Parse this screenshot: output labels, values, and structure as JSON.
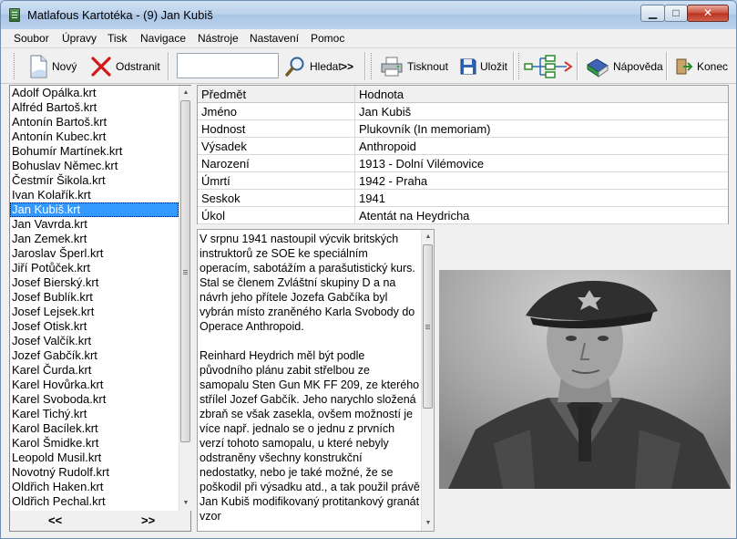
{
  "window": {
    "title": "Matlafous Kartotéka - (9) Jan Kubiš"
  },
  "menu": [
    "Soubor",
    "Úpravy",
    "Tisk",
    "Navigace",
    "Nástroje",
    "Nastavení",
    "Pomoc"
  ],
  "toolbar": {
    "new_label": "Nový",
    "delete_label": "Odstranit",
    "search_value": "",
    "find_label": "Hledat",
    "find_next_label": ">>",
    "print_label": "Tisknout",
    "save_label": "Uložit",
    "help_label": "Nápověda",
    "exit_label": "Konec"
  },
  "files": [
    "Adolf Opálka.krt",
    "Alfréd Bartoš.krt",
    "Antonín Bartoš.krt",
    "Antonín Kubec.krt",
    "Bohumír Martínek.krt",
    "Bohuslav Němec.krt",
    "Čestmír Šikola.krt",
    "Ivan Kolařík.krt",
    "Jan Kubiš.krt",
    "Jan Vavrda.krt",
    "Jan Zemek.krt",
    "Jaroslav Šperl.krt",
    "Jiří Potůček.krt",
    "Josef Bierský.krt",
    "Josef Bublík.krt",
    "Josef Lejsek.krt",
    "Josef Otisk.krt",
    "Josef Valčík.krt",
    "Jozef Gabčík.krt",
    "Karel Čurda.krt",
    "Karel Hovůrka.krt",
    "Karel Svoboda.krt",
    "Karel Tichý.krt",
    "Karol Bacílek.krt",
    "Karol Šmidke.krt",
    "Leopold Musil.krt",
    "Novotný Rudolf.krt",
    "Oldřich Haken.krt",
    "Oldřich Pechal.krt"
  ],
  "selected_index": 8,
  "pager": {
    "prev": "<<",
    "next": ">>"
  },
  "properties": {
    "header": {
      "key": "Předmět",
      "value": "Hodnota"
    },
    "rows": [
      {
        "key": "Jméno",
        "value": "Jan Kubiš"
      },
      {
        "key": "Hodnost",
        "value": "Plukovník (In memoriam)"
      },
      {
        "key": "Výsadek",
        "value": "Anthropoid"
      },
      {
        "key": "Narození",
        "value": "1913 - Dolní Vilémovice"
      },
      {
        "key": "Úmrtí",
        "value": "1942 - Praha"
      },
      {
        "key": "Seskok",
        "value": "1941"
      },
      {
        "key": "Úkol",
        "value": "Atentát na Heydricha"
      }
    ]
  },
  "description": {
    "p1": "V srpnu 1941 nastoupil výcvik britských instruktorů ze SOE ke speciálním operacím, sabotážím a parašutistický kurs. Stal se členem Zvláštní skupiny D a na návrh jeho přítele Jozefa Gabčíka byl vybrán místo zraněného Karla Svobody do Operace Anthropoid.",
    "p2": "Reinhard Heydrich měl být podle původního plánu zabit střelbou ze samopalu Sten Gun MK FF 209, ze kterého střílel Jozef Gabčík. Jeho narychlo složená zbraň se však zasekla, ovšem možností je více např. jednalo se o jednu z prvních verzí tohoto samopalu, u které nebyly odstraněny všechny konstrukční nedostatky, nebo je také možné, že se poškodil při výsadku atd., a tak použil právě Jan Kubiš modifikovaný protitankový granát vzor"
  }
}
